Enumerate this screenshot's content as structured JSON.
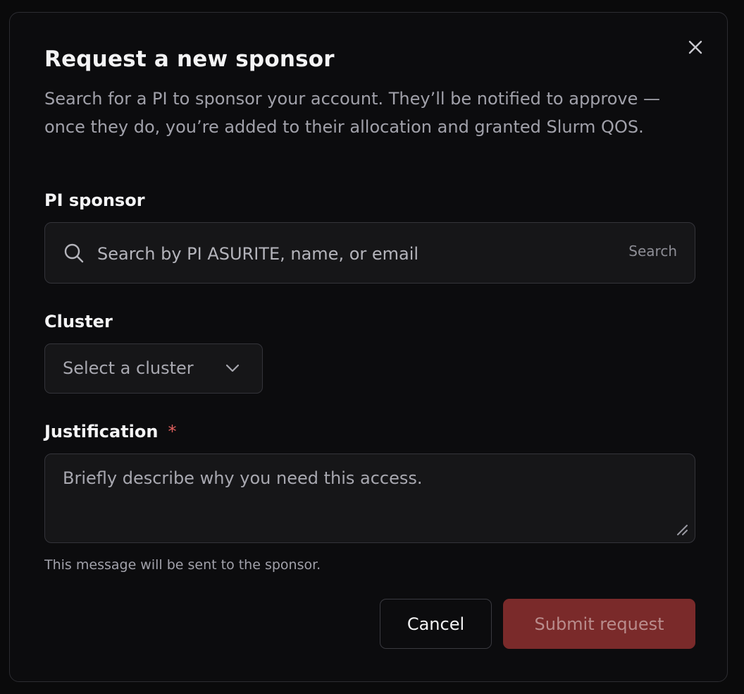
{
  "dialog": {
    "title": "Request a new sponsor",
    "description": "Search for a PI to sponsor your account. They’ll be notified to approve — once they do, you’re added to their allocation and granted Slurm QOS.",
    "close_icon": "close-icon"
  },
  "pi_sponsor": {
    "label": "PI sponsor",
    "placeholder": "Search by PI ASURITE, name, or email",
    "search_button": "Search",
    "icon": "search-icon"
  },
  "cluster": {
    "label": "Cluster",
    "selected": "Select a cluster",
    "icon": "chevron-down-icon"
  },
  "justification": {
    "label": "Justification",
    "required_mark": "*",
    "placeholder": "Briefly describe why you need this access.",
    "helper": "This message will be sent to the sponsor."
  },
  "actions": {
    "cancel": "Cancel",
    "submit": "Submit request"
  },
  "colors": {
    "background": "#0c0c0e",
    "field_background": "#161618",
    "required": "#e0605e",
    "submit_disabled": "#7a2a2a"
  }
}
